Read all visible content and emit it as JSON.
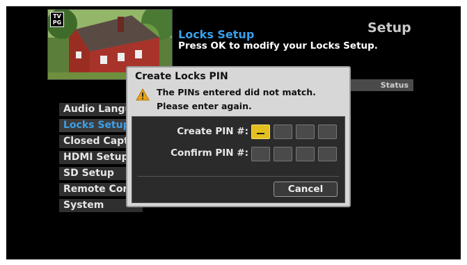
{
  "header": {
    "title": "Setup",
    "heading": "Locks Setup",
    "subheading": "Press OK to modify your Locks Setup."
  },
  "thumbnail": {
    "rating_line1": "TV",
    "rating_line2": "PG"
  },
  "status_column": {
    "label": "Status"
  },
  "menu": {
    "items": [
      {
        "label": "Audio Language"
      },
      {
        "label": "Locks Setup",
        "active": true
      },
      {
        "label": "Closed Captions"
      },
      {
        "label": "HDMI Setup"
      },
      {
        "label": "SD Setup"
      },
      {
        "label": "Remote Control"
      },
      {
        "label": "System"
      }
    ]
  },
  "dialog": {
    "title": "Create Locks PIN",
    "message_line1": "The PINs entered did not match.",
    "message_line2": "Please enter again.",
    "create_label": "Create PIN #:",
    "confirm_label": "Confirm PIN #:",
    "cancel_label": "Cancel",
    "warning_icon": "warning-triangle-icon",
    "accent_color": "#e3c020"
  }
}
